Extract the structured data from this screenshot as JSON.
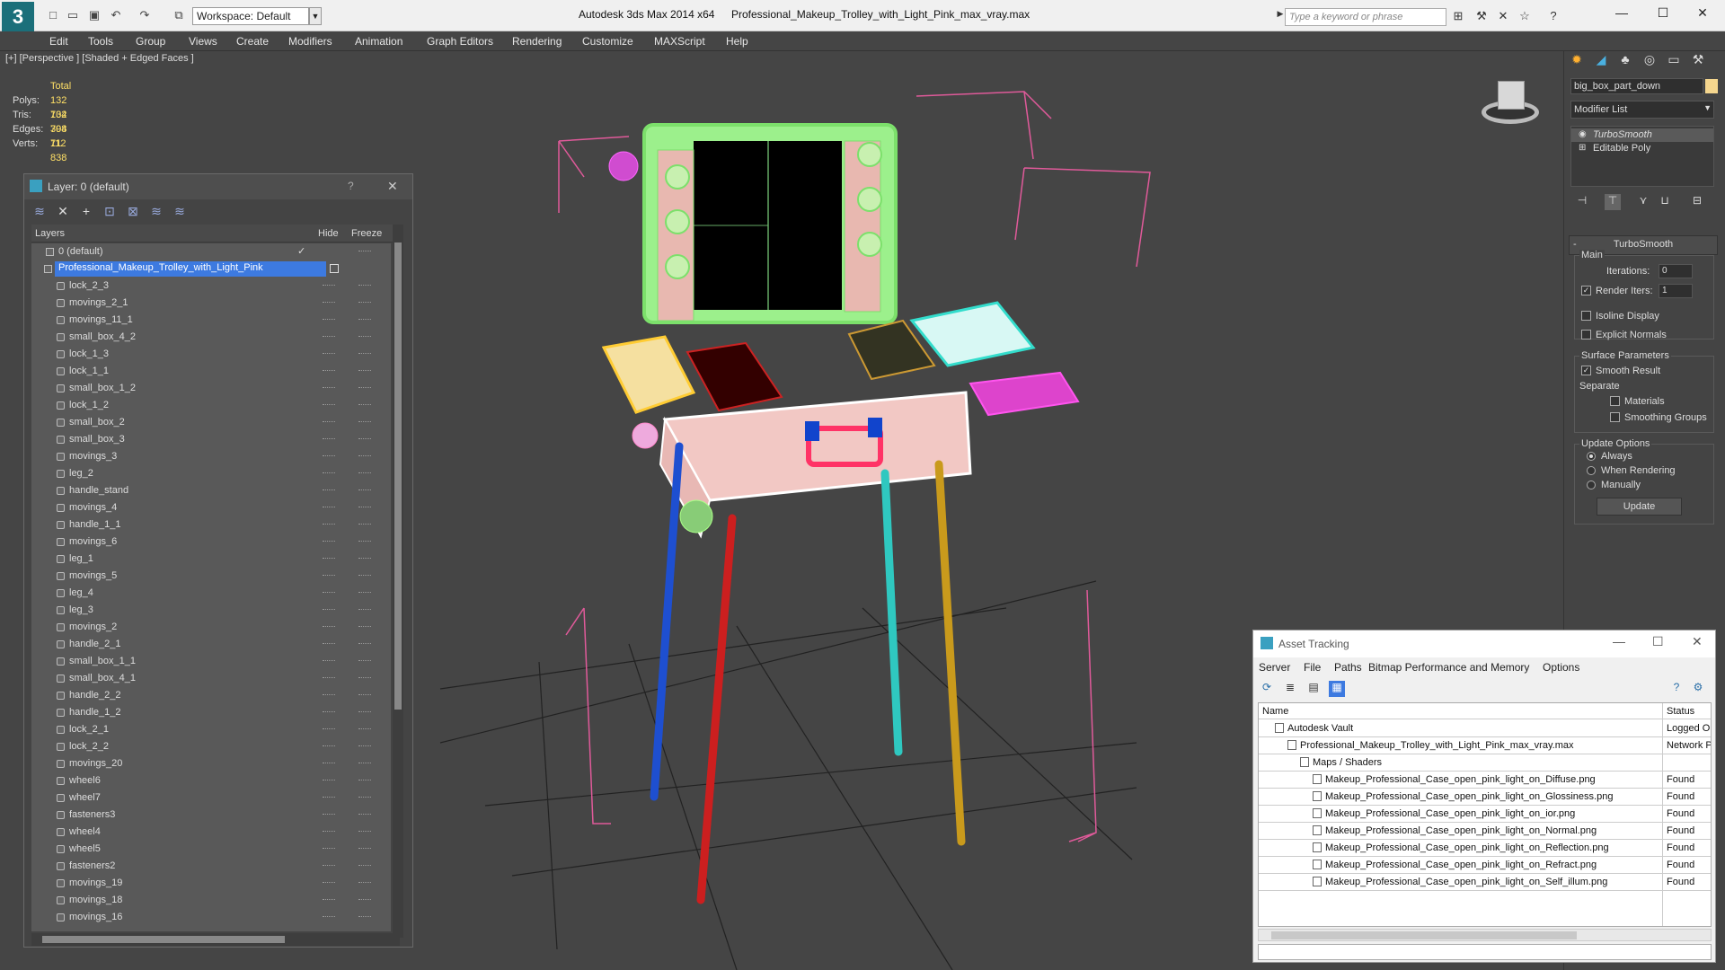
{
  "titlebar": {
    "app_title": "Autodesk 3ds Max  2014 x64",
    "document": "Professional_Makeup_Trolley_with_Light_Pink_max_vray.max",
    "workspace": "Workspace: Default",
    "search_placeholder": "Type a keyword or phrase"
  },
  "menu": [
    "Edit",
    "Tools",
    "Group",
    "Views",
    "Create",
    "Modifiers",
    "Animation",
    "Graph Editors",
    "Rendering",
    "Customize",
    "MAXScript",
    "Help"
  ],
  "viewport": {
    "label": "[+] [Perspective ] [Shaded + Edged Faces ]",
    "stats": {
      "total_label": "Total",
      "polys_label": "Polys:",
      "polys": "132 704",
      "tris_label": "Tris:",
      "tris": "132 704",
      "edges_label": "Edges:",
      "edges": "398 112",
      "verts_label": "Verts:",
      "verts": "71 838"
    }
  },
  "layer_window": {
    "title": "Layer: 0 (default)",
    "help": "?",
    "columns": {
      "layers": "Layers",
      "hide": "Hide",
      "freeze": "Freeze"
    },
    "root_items": [
      "0 (default)",
      "Professional_Makeup_Trolley_with_Light_Pink"
    ],
    "children": [
      "lock_2_3",
      "movings_2_1",
      "movings_11_1",
      "small_box_4_2",
      "lock_1_3",
      "lock_1_1",
      "small_box_1_2",
      "lock_1_2",
      "small_box_2",
      "small_box_3",
      "movings_3",
      "leg_2",
      "handle_stand",
      "movings_4",
      "handle_1_1",
      "movings_6",
      "leg_1",
      "movings_5",
      "leg_4",
      "leg_3",
      "movings_2",
      "handle_2_1",
      "small_box_1_1",
      "small_box_4_1",
      "handle_2_2",
      "handle_1_2",
      "lock_2_1",
      "lock_2_2",
      "movings_20",
      "wheel6",
      "wheel7",
      "fasteners3",
      "wheel4",
      "wheel5",
      "fasteners2",
      "movings_19",
      "movings_18",
      "movings_16"
    ]
  },
  "command_panel": {
    "object_name": "big_box_part_down",
    "object_color": "#f5d68e",
    "modifier_list": "Modifier List",
    "stack": [
      "TurboSmooth",
      "Editable Poly"
    ],
    "rollout": "TurboSmooth",
    "main_label": "Main",
    "iterations_label": "Iterations:",
    "iterations": "0",
    "render_iters_label": "Render Iters:",
    "render_iters": "1",
    "isoline": "Isoline Display",
    "explicit_normals": "Explicit Normals",
    "surface_params": "Surface Parameters",
    "smooth_result": "Smooth Result",
    "separate": "Separate",
    "materials": "Materials",
    "smoothing_groups": "Smoothing Groups",
    "update_options": "Update Options",
    "always": "Always",
    "when_rendering": "When Rendering",
    "manually": "Manually",
    "update_button": "Update"
  },
  "asset_tracking": {
    "title": "Asset Tracking",
    "menu": [
      "Server",
      "File",
      "Paths",
      "Bitmap Performance and Memory",
      "Options"
    ],
    "columns": {
      "name": "Name",
      "status": "Status"
    },
    "rows": [
      {
        "name": "Autodesk Vault",
        "status": "Logged Ou"
      },
      {
        "name": "Professional_Makeup_Trolley_with_Light_Pink_max_vray.max",
        "status": "Network P"
      },
      {
        "name": "Maps / Shaders",
        "status": ""
      },
      {
        "name": "Makeup_Professional_Case_open_pink_light_on_Diffuse.png",
        "status": "Found"
      },
      {
        "name": "Makeup_Professional_Case_open_pink_light_on_Glossiness.png",
        "status": "Found"
      },
      {
        "name": "Makeup_Professional_Case_open_pink_light_on_ior.png",
        "status": "Found"
      },
      {
        "name": "Makeup_Professional_Case_open_pink_light_on_Normal.png",
        "status": "Found"
      },
      {
        "name": "Makeup_Professional_Case_open_pink_light_on_Reflection.png",
        "status": "Found"
      },
      {
        "name": "Makeup_Professional_Case_open_pink_light_on_Refract.png",
        "status": "Found"
      },
      {
        "name": "Makeup_Professional_Case_open_pink_light_on_Self_illum.png",
        "status": "Found"
      }
    ]
  }
}
